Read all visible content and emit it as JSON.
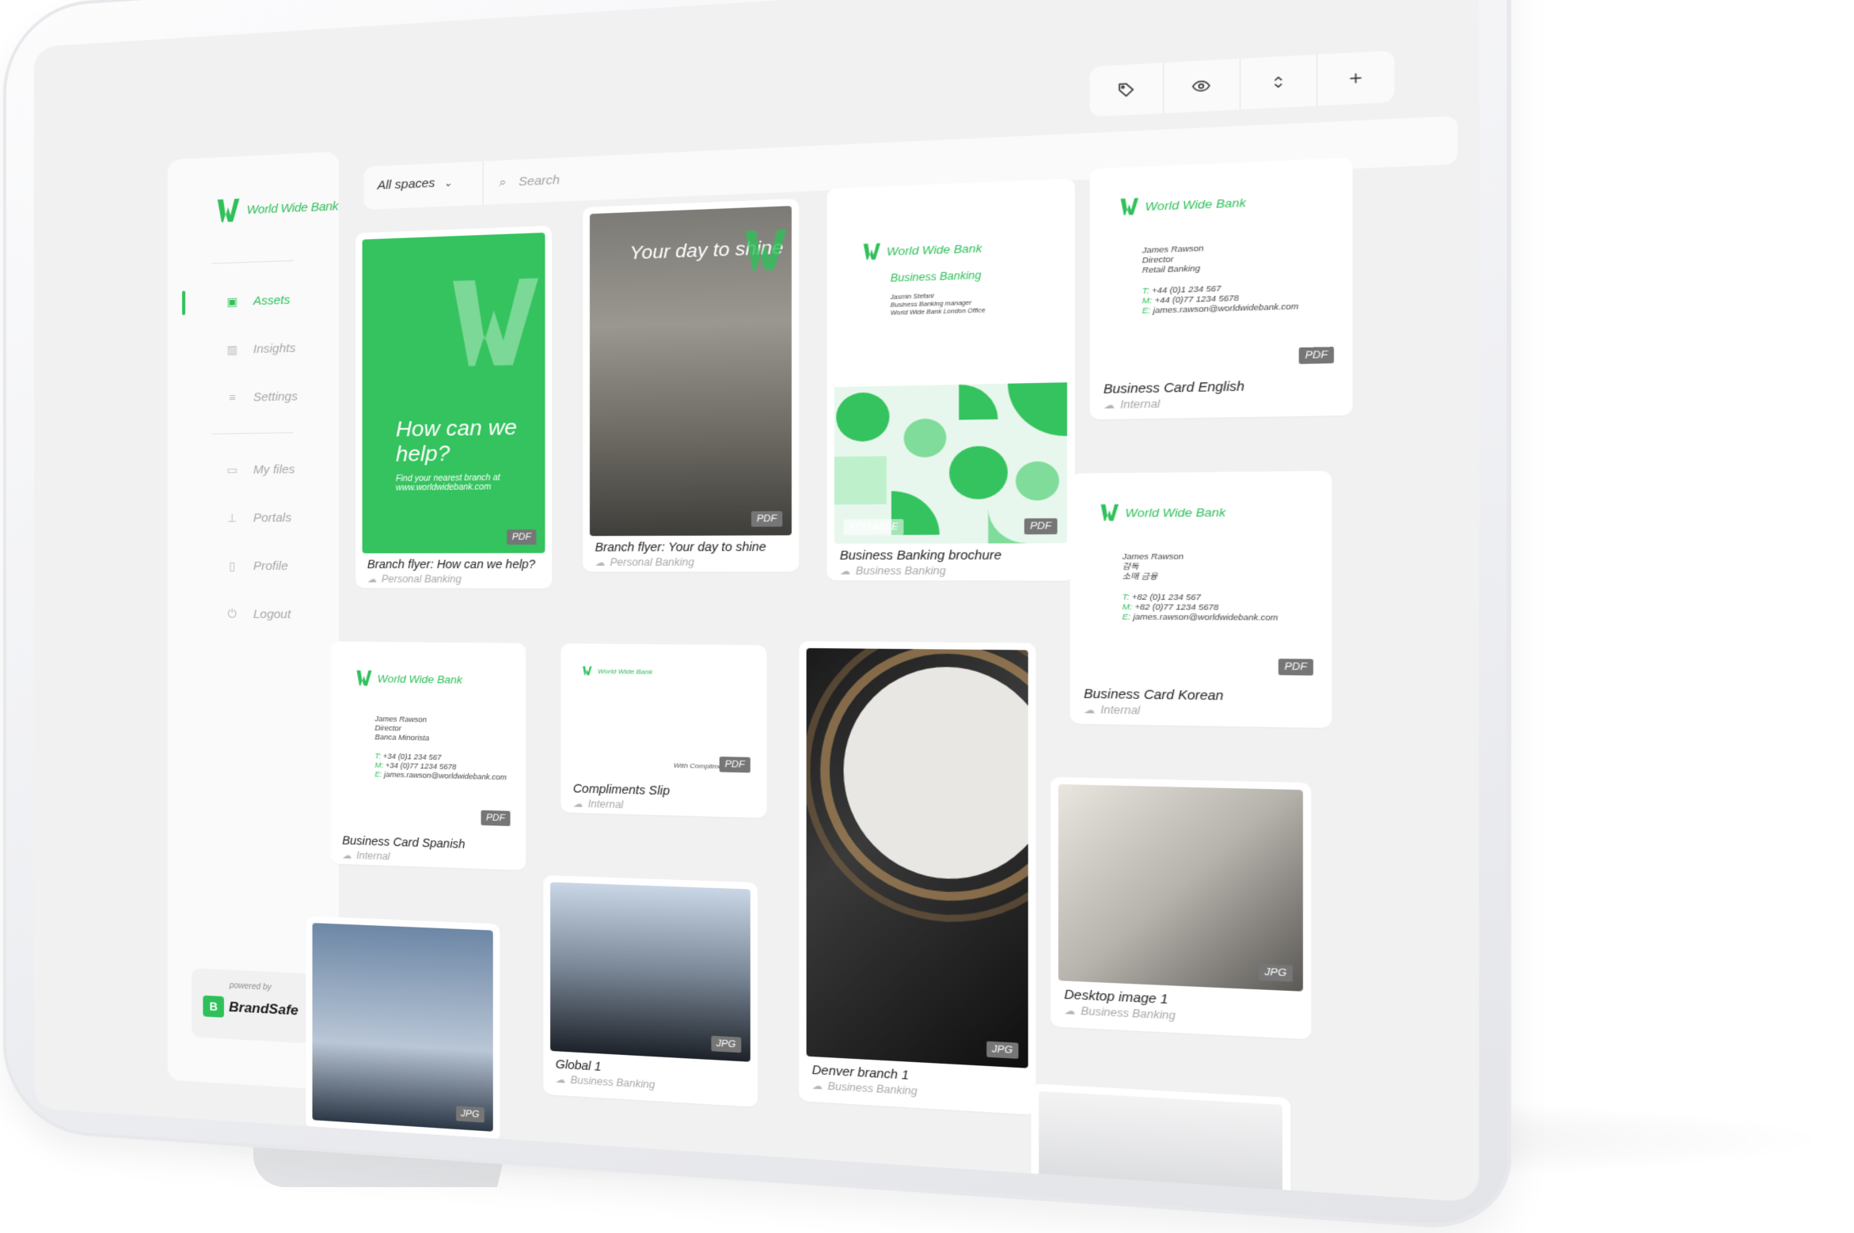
{
  "app": {
    "logo_text": "World Wide Bank",
    "brand_color": "#2fc05a",
    "powered_label": "powered by",
    "powered_brand": "BrandSafe"
  },
  "sidebar": {
    "items": [
      {
        "label": "Assets",
        "icon": "image-icon",
        "active": true
      },
      {
        "label": "Insights",
        "icon": "chart-icon"
      },
      {
        "label": "Settings",
        "icon": "sliders-icon"
      },
      {
        "label": "My files",
        "icon": "folder-icon"
      },
      {
        "label": "Portals",
        "icon": "sitemap-icon"
      },
      {
        "label": "Profile",
        "icon": "id-card-icon"
      },
      {
        "label": "Logout",
        "icon": "power-icon"
      }
    ]
  },
  "topbar": {
    "spaces_label": "All spaces",
    "search_placeholder": "Search"
  },
  "toolbar": {
    "buttons": [
      "tag-icon",
      "eye-icon",
      "sort-icon",
      "plus-icon"
    ]
  },
  "assets": [
    {
      "title": "Branch flyer: How can we help?",
      "space": "Personal Banking",
      "type": "PDF",
      "thumb_text": "How can we help?",
      "thumb_small": "Find your nearest branch at www.worldwidebank.com"
    },
    {
      "title": "Branch flyer: Your day to shine",
      "space": "Personal Banking",
      "type": "PDF",
      "thumb_text": "Your day to shine"
    },
    {
      "title": "Business Banking brochure",
      "space": "Business Banking",
      "type": "PDF",
      "editable": "EDITABLE",
      "thumb_heading": "Business Banking",
      "thumb_lines": [
        "Jasmin Stefani",
        "Business Banking manager",
        "World Wide Bank London Office"
      ]
    },
    {
      "title": "Business Card English",
      "space": "Internal",
      "type": "PDF",
      "thumb_lines": [
        "James Rawson",
        "Director",
        "Retail Banking"
      ],
      "contact": {
        "t": "+44 (0)1 234 567",
        "m": "+44 (0)77 1234 5678",
        "e": "james.rawson@worldwidebank.com"
      }
    },
    {
      "title": "Business Card Korean",
      "space": "Internal",
      "type": "PDF",
      "thumb_lines": [
        "James Rawson",
        "감독",
        "소매 금융"
      ],
      "contact": {
        "t": "+82 (0)1 234 567",
        "m": "+82 (0)77 1234 5678",
        "e": "james.rawson@worldwidebank.com"
      }
    },
    {
      "title": "Business Card Spanish",
      "space": "Internal",
      "type": "PDF",
      "thumb_lines": [
        "James Rawson",
        "Director",
        "Banca Minorista"
      ],
      "contact": {
        "t": "+34 (0)1 234 567",
        "m": "+34 (0)77 1234 5678",
        "e": "james.rawson@worldwidebank.com"
      }
    },
    {
      "title": "Compliments Slip",
      "space": "Internal",
      "type": "PDF",
      "thumb_caption": "With Compliments"
    },
    {
      "title": "Denver branch 1",
      "space": "Business Banking",
      "type": "JPG"
    },
    {
      "title": "Desktop image 1",
      "space": "Business Banking",
      "type": "JPG"
    },
    {
      "title": "Global 1",
      "space": "Business Banking",
      "type": "JPG"
    },
    {
      "title": "",
      "space": "",
      "type": "JPG"
    }
  ],
  "labels": {
    "t": "T:",
    "m": "M:",
    "e": "E:"
  }
}
